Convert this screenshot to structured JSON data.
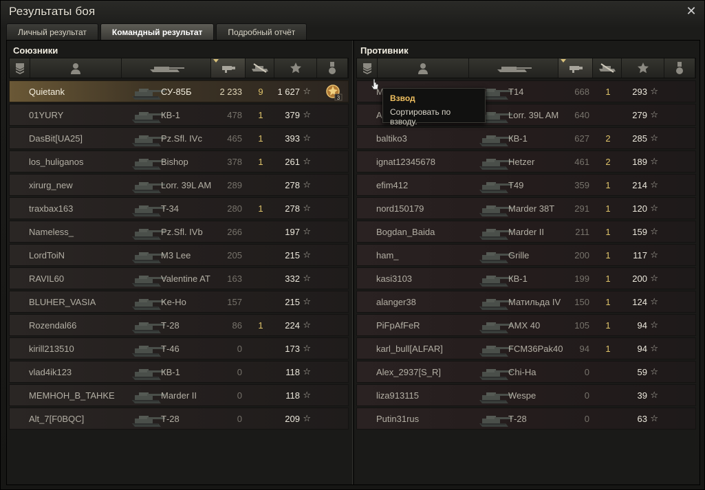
{
  "window": {
    "title": "Результаты боя",
    "close_label": "✕"
  },
  "tabs": [
    {
      "label": "Личный результат",
      "active": false
    },
    {
      "label": "Командный результат",
      "active": true
    },
    {
      "label": "Подробный отчёт",
      "active": false
    }
  ],
  "tooltip": {
    "title": "Взвод",
    "text": "Сортировать по взводу."
  },
  "allies": {
    "title": "Союзники",
    "rows": [
      {
        "name": "Quietank",
        "tank": "СУ-85Б",
        "damage": "2 233",
        "frags": "9",
        "xp": "1 627",
        "highlight": true,
        "medal": "3"
      },
      {
        "name": "01YURY",
        "tank": "КВ-1",
        "damage": "478",
        "frags": "1",
        "xp": "379"
      },
      {
        "name": "DasBit[UA25]",
        "tank": "Pz.Sfl. IVc",
        "damage": "465",
        "frags": "1",
        "xp": "393"
      },
      {
        "name": "los_huliganos",
        "tank": "Bishop",
        "damage": "378",
        "frags": "1",
        "xp": "261"
      },
      {
        "name": "xirurg_new",
        "tank": "Lorr. 39L AM",
        "damage": "289",
        "frags": "",
        "xp": "278"
      },
      {
        "name": "traxbax163",
        "tank": "T-34",
        "damage": "280",
        "frags": "1",
        "xp": "278"
      },
      {
        "name": "Nameless_",
        "tank": "Pz.Sfl. IVb",
        "damage": "266",
        "frags": "",
        "xp": "197"
      },
      {
        "name": "LordToiN",
        "tank": "M3 Lee",
        "damage": "205",
        "frags": "",
        "xp": "215"
      },
      {
        "name": "RAVIL60",
        "tank": "Valentine AT",
        "damage": "163",
        "frags": "",
        "xp": "332"
      },
      {
        "name": "BLUHER_VASIA",
        "tank": "Ke-Ho",
        "damage": "157",
        "frags": "",
        "xp": "215"
      },
      {
        "name": "Rozendal66",
        "tank": "Т-28",
        "damage": "86",
        "frags": "1",
        "xp": "224"
      },
      {
        "name": "kirill213510",
        "tank": "Т-46",
        "damage": "0",
        "frags": "",
        "xp": "173"
      },
      {
        "name": "vlad4ik123",
        "tank": "КВ-1",
        "damage": "0",
        "frags": "",
        "xp": "118"
      },
      {
        "name": "MEMHOH_B_TAHKE",
        "tank": "Marder II",
        "damage": "0",
        "frags": "",
        "xp": "118"
      },
      {
        "name": "Alt_7[F0BQC]",
        "tank": "Т-28",
        "damage": "0",
        "frags": "",
        "xp": "209"
      }
    ]
  },
  "enemies": {
    "title": "Противник",
    "rows": [
      {
        "name": "M",
        "tank": "T14",
        "damage": "668",
        "frags": "1",
        "xp": "293"
      },
      {
        "name": "A",
        "tank": "Lorr. 39L AM",
        "damage": "640",
        "frags": "",
        "xp": "279"
      },
      {
        "name": "baltiko3",
        "tank": "КВ-1",
        "damage": "627",
        "frags": "2",
        "xp": "285"
      },
      {
        "name": "ignat12345678",
        "tank": "Hetzer",
        "damage": "461",
        "frags": "2",
        "xp": "189"
      },
      {
        "name": "efim412",
        "tank": "T49",
        "damage": "359",
        "frags": "1",
        "xp": "214"
      },
      {
        "name": "nord150179",
        "tank": "Marder 38T",
        "damage": "291",
        "frags": "1",
        "xp": "120"
      },
      {
        "name": "Bogdan_Baida",
        "tank": "Marder II",
        "damage": "211",
        "frags": "1",
        "xp": "159"
      },
      {
        "name": "ham_",
        "tank": "Grille",
        "damage": "200",
        "frags": "1",
        "xp": "117"
      },
      {
        "name": "kasi3103",
        "tank": "КВ-1",
        "damage": "199",
        "frags": "1",
        "xp": "200"
      },
      {
        "name": "alanger38",
        "tank": "Матильда IV",
        "damage": "150",
        "frags": "1",
        "xp": "124"
      },
      {
        "name": "PiFpAfFeR",
        "tank": "AMX 40",
        "damage": "105",
        "frags": "1",
        "xp": "94"
      },
      {
        "name": "karl_bull[ALFAR]",
        "tank": "FCM36Pak40",
        "damage": "94",
        "frags": "1",
        "xp": "94"
      },
      {
        "name": "Alex_2937[S_R]",
        "tank": "Chi-Ha",
        "damage": "0",
        "frags": "",
        "xp": "59"
      },
      {
        "name": "liza913115",
        "tank": "Wespe",
        "damage": "0",
        "frags": "",
        "xp": "39"
      },
      {
        "name": "Putin31rus",
        "tank": "Т-28",
        "damage": "0",
        "frags": "",
        "xp": "63"
      }
    ]
  },
  "colors": {
    "accent": "#e0c46a",
    "tooltip_title": "#f0c060"
  }
}
